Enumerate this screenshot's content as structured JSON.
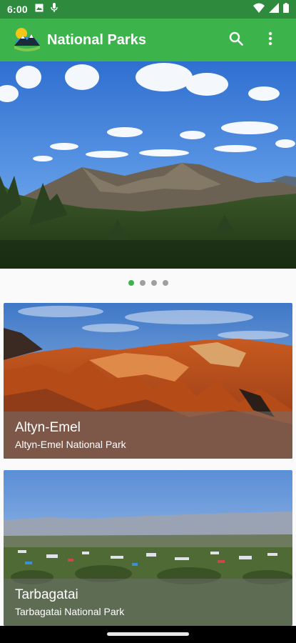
{
  "status_bar": {
    "time": "6:00",
    "left_icons": [
      "photo-icon",
      "mic-icon"
    ],
    "right_icons": [
      "wifi-icon",
      "signal-icon",
      "battery-icon"
    ]
  },
  "app_bar": {
    "title": "National Parks",
    "logo": "park-logo-icon",
    "actions": [
      "search-icon",
      "overflow-menu-icon"
    ]
  },
  "carousel": {
    "hero_image": "mountain landscape with forest",
    "page_count": 4,
    "active_index": 0
  },
  "parks": [
    {
      "title": "Altyn-Emel",
      "subtitle": "Altyn-Emel National Park"
    },
    {
      "title": "Tarbagatai",
      "subtitle": "Tarbagatai National Park"
    }
  ],
  "colors": {
    "status_bar": "#2e8b3e",
    "app_bar": "#3cb44b",
    "accent": "#3cb44b",
    "dot_inactive": "#9e9e9e"
  }
}
